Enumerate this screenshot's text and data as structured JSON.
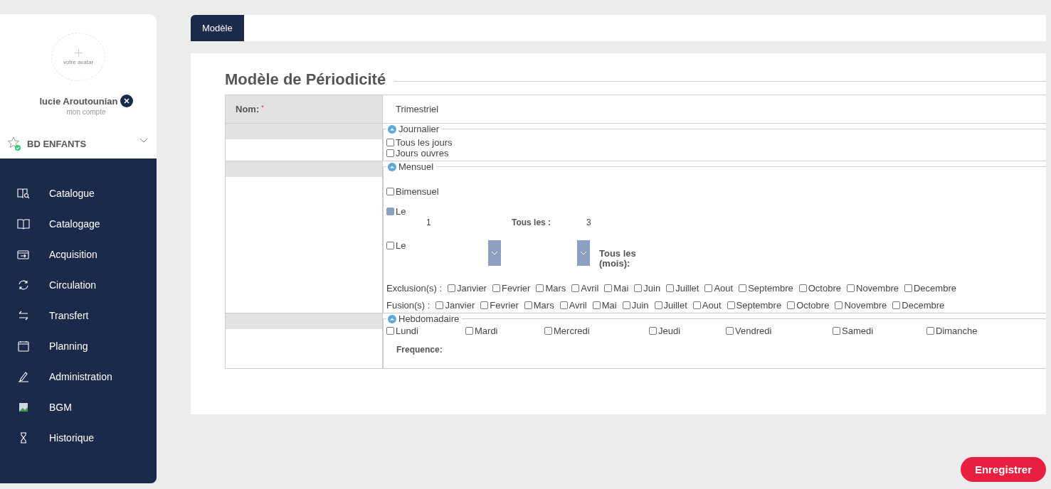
{
  "user": {
    "avatar_label": "votre avatar",
    "name": "lucie Aroutounian",
    "account": "mon compte"
  },
  "library": {
    "name": "BD ENFANTS"
  },
  "nav": [
    {
      "label": "Catalogue",
      "kind": "catalogue"
    },
    {
      "label": "Catalogage",
      "kind": "book"
    },
    {
      "label": "Acquisition",
      "kind": "inbox"
    },
    {
      "label": "Circulation",
      "kind": "cycle"
    },
    {
      "label": "Transfert",
      "kind": "transfer"
    },
    {
      "label": "Planning",
      "kind": "calendar"
    },
    {
      "label": "Administration",
      "kind": "pen"
    },
    {
      "label": "BGM",
      "kind": "image"
    },
    {
      "label": "Historique",
      "kind": "hourglass"
    }
  ],
  "tabs": [
    {
      "label": "Modèle",
      "selected": true
    }
  ],
  "form": {
    "title": "Modèle de Périodicité",
    "name_label": "Nom:",
    "required_mark": "*",
    "name_value": "Trimestriel",
    "journalier": {
      "legend": "Journalier",
      "options": [
        {
          "label": "Tous les jours",
          "checked": false
        },
        {
          "label": "Jours ouvres",
          "checked": false
        }
      ]
    },
    "mensuel": {
      "legend": "Mensuel",
      "bimensuel": {
        "label": "Bimensuel",
        "checked": false
      },
      "le_day": {
        "label": "Le",
        "checked": true,
        "day": "1",
        "every_label": "Tous les :",
        "every_value": "3"
      },
      "le_weekday": {
        "label": "Le",
        "checked": false,
        "every_label": "Tous les (mois):"
      },
      "month_rows": [
        {
          "label": "Exclusion(s) :",
          "months": [
            {
              "label": "Janvier",
              "checked": false
            },
            {
              "label": "Fevrier",
              "checked": false
            },
            {
              "label": "Mars",
              "checked": false
            },
            {
              "label": "Avril",
              "checked": false
            },
            {
              "label": "Mai",
              "checked": false
            },
            {
              "label": "Juin",
              "checked": false
            },
            {
              "label": "Juillet",
              "checked": false
            },
            {
              "label": "Aout",
              "checked": false
            },
            {
              "label": "Septembre",
              "checked": false
            },
            {
              "label": "Octobre",
              "checked": false
            },
            {
              "label": "Novembre",
              "checked": false
            },
            {
              "label": "Decembre",
              "checked": false
            }
          ]
        },
        {
          "label": "Fusion(s) :",
          "months": [
            {
              "label": "Janvier",
              "checked": false
            },
            {
              "label": "Fevrier",
              "checked": false
            },
            {
              "label": "Mars",
              "checked": false
            },
            {
              "label": "Avril",
              "checked": false
            },
            {
              "label": "Mai",
              "checked": false
            },
            {
              "label": "Juin",
              "checked": false
            },
            {
              "label": "Juillet",
              "checked": false
            },
            {
              "label": "Aout",
              "checked": false
            },
            {
              "label": "Septembre",
              "checked": false
            },
            {
              "label": "Octobre",
              "checked": false
            },
            {
              "label": "Novembre",
              "checked": false
            },
            {
              "label": "Decembre",
              "checked": false
            }
          ]
        }
      ]
    },
    "hebdomadaire": {
      "legend": "Hebdomadaire",
      "days": [
        {
          "label": "Lundi",
          "checked": false
        },
        {
          "label": "Mardi",
          "checked": false
        },
        {
          "label": "Mercredi",
          "checked": false
        },
        {
          "label": "Jeudi",
          "checked": false
        },
        {
          "label": "Vendredi",
          "checked": false
        },
        {
          "label": "Samedi",
          "checked": false
        },
        {
          "label": "Dimanche",
          "checked": false
        }
      ],
      "frequency_label": "Frequence:"
    }
  },
  "save_button": "Enregistrer"
}
